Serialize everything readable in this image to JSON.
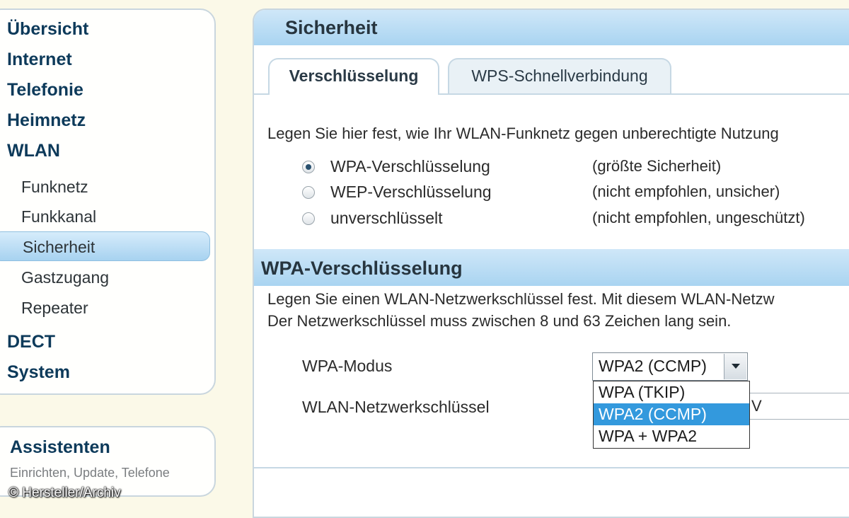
{
  "sidebar": {
    "items": [
      {
        "label": "Übersicht"
      },
      {
        "label": "Internet"
      },
      {
        "label": "Telefonie"
      },
      {
        "label": "Heimnetz"
      },
      {
        "label": "WLAN"
      },
      {
        "label": "Funknetz"
      },
      {
        "label": "Funkkanal"
      },
      {
        "label": "Sicherheit",
        "active": true
      },
      {
        "label": "Gastzugang"
      },
      {
        "label": "Repeater"
      },
      {
        "label": "DECT"
      },
      {
        "label": "System"
      }
    ],
    "assistants": {
      "title": "Assistenten",
      "subtitle": "Einrichten, Update, Telefone"
    }
  },
  "credit": "© Hersteller/Archiv",
  "main": {
    "title": "Sicherheit",
    "tabs": [
      {
        "label": "Verschlüsselung",
        "active": true
      },
      {
        "label": "WPS-Schnellverbindung",
        "active": false
      }
    ],
    "intro": "Legen Sie hier fest, wie Ihr WLAN-Funknetz gegen unberechtigte Nutzung",
    "encryption_options": [
      {
        "label": "WPA-Verschlüsselung",
        "note": "(größte Sicherheit)",
        "checked": true
      },
      {
        "label": "WEP-Verschlüsselung",
        "note": "(nicht empfohlen, unsicher)",
        "checked": false
      },
      {
        "label": "unverschlüsselt",
        "note": "(nicht empfohlen, ungeschützt)",
        "checked": false
      }
    ],
    "wpa_section": {
      "title": "WPA-Verschlüsselung",
      "desc_line1": "Legen Sie einen WLAN-Netzwerkschlüssel fest. Mit diesem WLAN-Netzw",
      "desc_line2": "Der Netzwerkschlüssel muss zwischen 8 und 63 Zeichen lang sein.",
      "mode_label": "WPA-Modus",
      "mode_selected": "WPA2 (CCMP)",
      "mode_options": [
        "WPA (TKIP)",
        "WPA2 (CCMP)",
        "WPA + WPA2"
      ],
      "key_label": "WLAN-Netzwerkschlüssel",
      "key_value": "V"
    }
  }
}
